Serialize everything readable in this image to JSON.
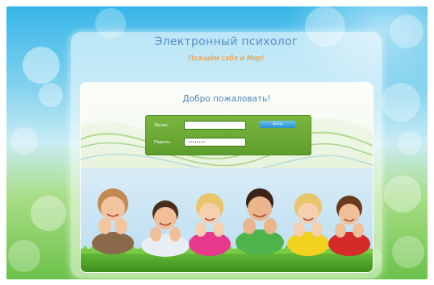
{
  "header": {
    "title": "Электронный психолог",
    "tagline": "Познаём себя и Мир!"
  },
  "main": {
    "welcome": "Добро пожаловать!"
  },
  "login_form": {
    "login_label": "Логин:",
    "password_label": "Пароль:",
    "login_value": "",
    "password_value": "••••••••",
    "submit_label": "Вход"
  },
  "colors": {
    "title": "#5a8fc6",
    "tagline": "#f08a1d",
    "form_green": "#6aa936",
    "button_blue": "#2b8fd0"
  },
  "icons": {
    "photo": "children-lying-on-grass-photo"
  }
}
